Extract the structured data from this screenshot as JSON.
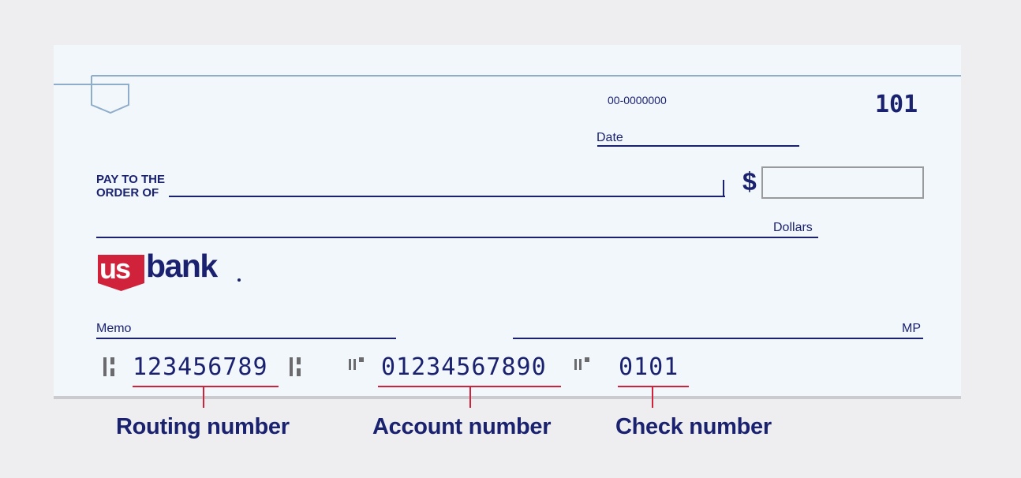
{
  "check": {
    "bank_fraction": "00-0000000",
    "check_number_top": "101",
    "date_label": "Date",
    "pay_to_label_line1": "PAY TO THE",
    "pay_to_label_line2": "ORDER OF",
    "dollar_sign": "$",
    "amount_value": "",
    "dollars_label": "Dollars",
    "memo_label": "Memo",
    "signature_label": "MP",
    "logo": {
      "shield_text": "us",
      "word_text": "bank",
      "shield_color": "#d0223a",
      "word_color": "#1a2270"
    },
    "micr": {
      "routing": "123456789",
      "account": "01234567890",
      "check": "0101"
    }
  },
  "captions": {
    "routing": "Routing number",
    "account": "Account number",
    "check": "Check number"
  },
  "colors": {
    "ink": "#1a2270",
    "highlight": "#d0223a",
    "check_bg": "#f2f7fc",
    "page_bg": "#eeeef0"
  }
}
